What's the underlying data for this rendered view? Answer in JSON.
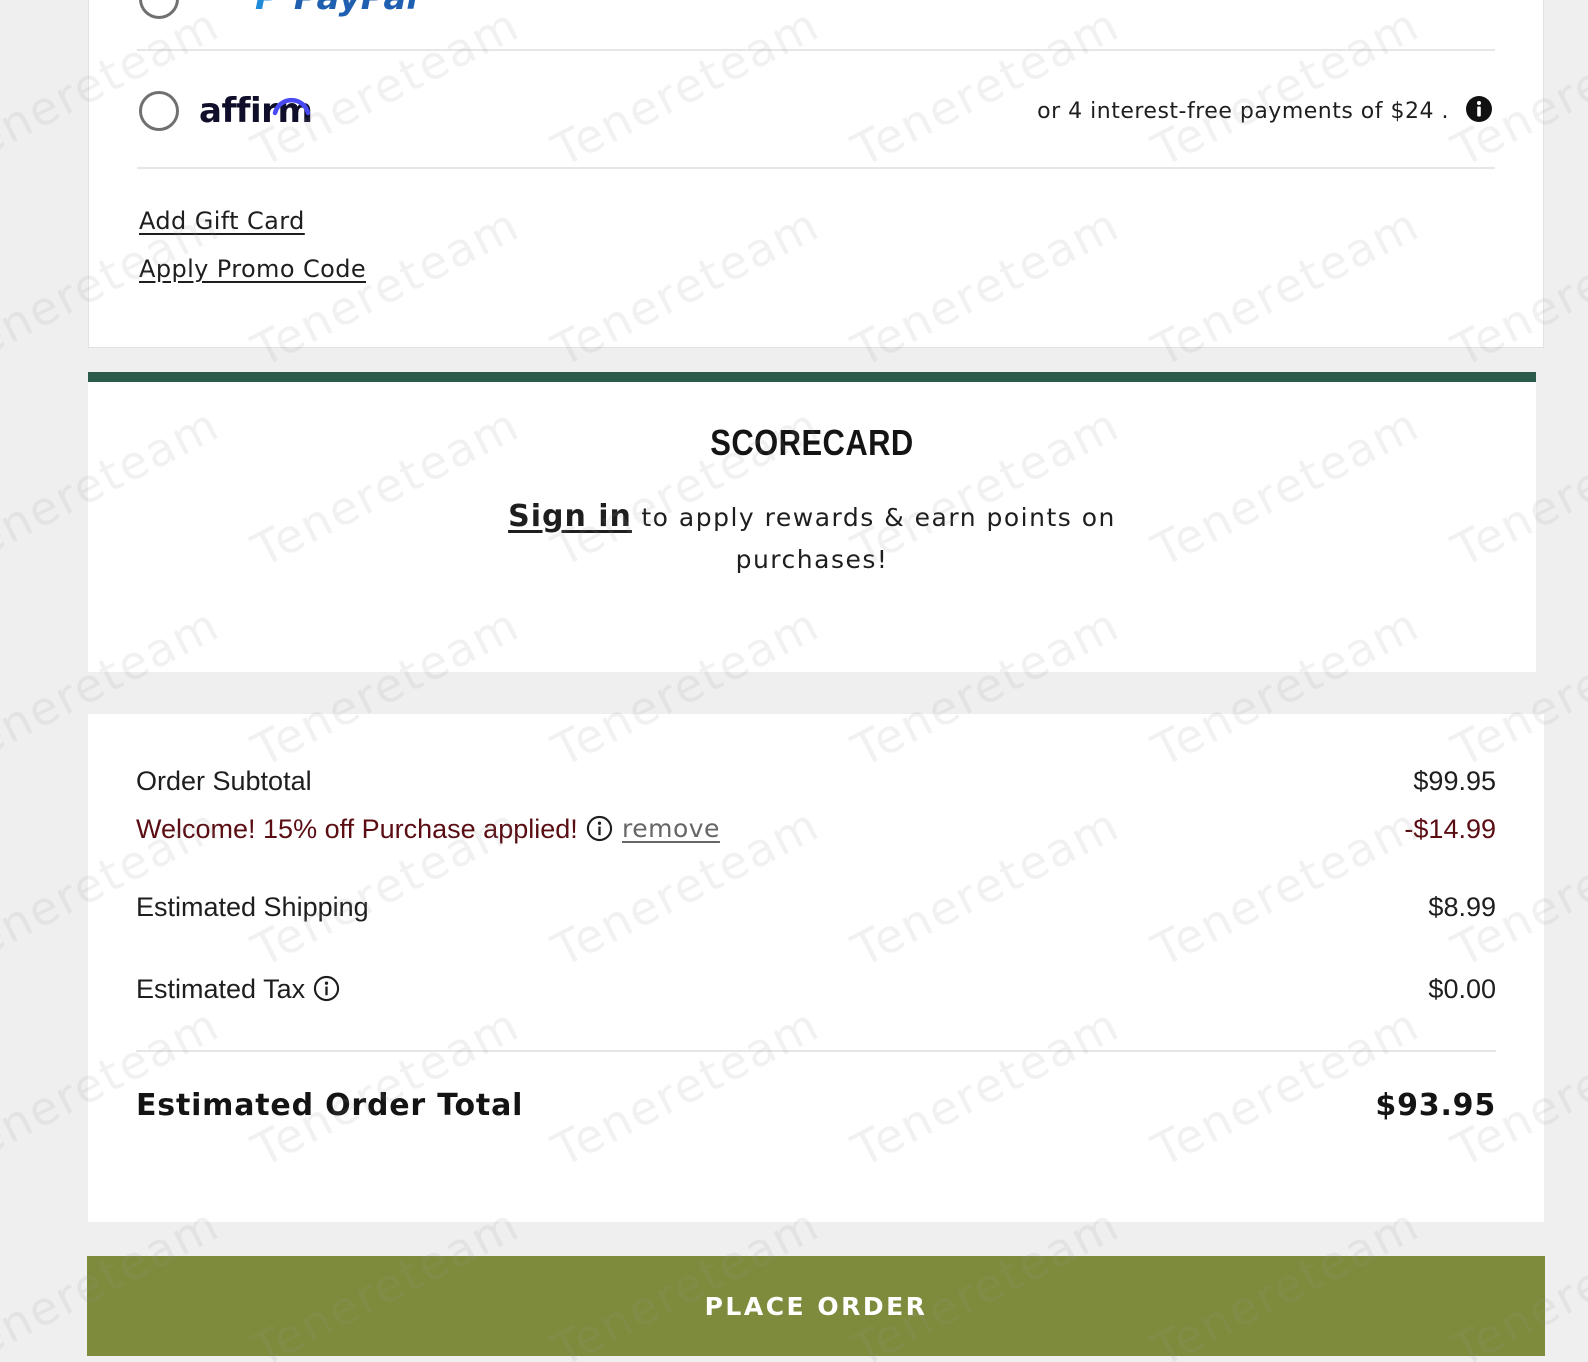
{
  "payment": {
    "paypal": {
      "logo_text": "PayPal",
      "selected": false
    },
    "affirm": {
      "logo_text": "affirm",
      "selected": false,
      "installment_text": "or 4 interest-free payments of $24 .",
      "info_icon": "info-filled-icon"
    },
    "links": {
      "gift_card": "Add Gift Card",
      "promo_code": "Apply Promo Code"
    }
  },
  "scorecard": {
    "title": "SCORECARD",
    "sign_in_label": "Sign in",
    "message": "to apply rewards & earn points on purchases!",
    "accent_color": "#2b5b4a"
  },
  "summary": {
    "subtotal": {
      "label": "Order Subtotal",
      "value": "$99.95"
    },
    "promo": {
      "label": "Welcome! 15% off Purchase applied!",
      "remove_label": "remove",
      "value": "-$14.99",
      "color": "#5a0d13"
    },
    "shipping": {
      "label": "Estimated Shipping",
      "value": "$8.99"
    },
    "tax": {
      "label": "Estimated Tax",
      "value": "$0.00"
    },
    "total": {
      "label": "Estimated Order Total",
      "value": "$93.95"
    }
  },
  "actions": {
    "place_order_label": "PLACE ORDER",
    "place_order_color": "#7f8b3c"
  },
  "watermark": {
    "text": "Tenereteam"
  }
}
